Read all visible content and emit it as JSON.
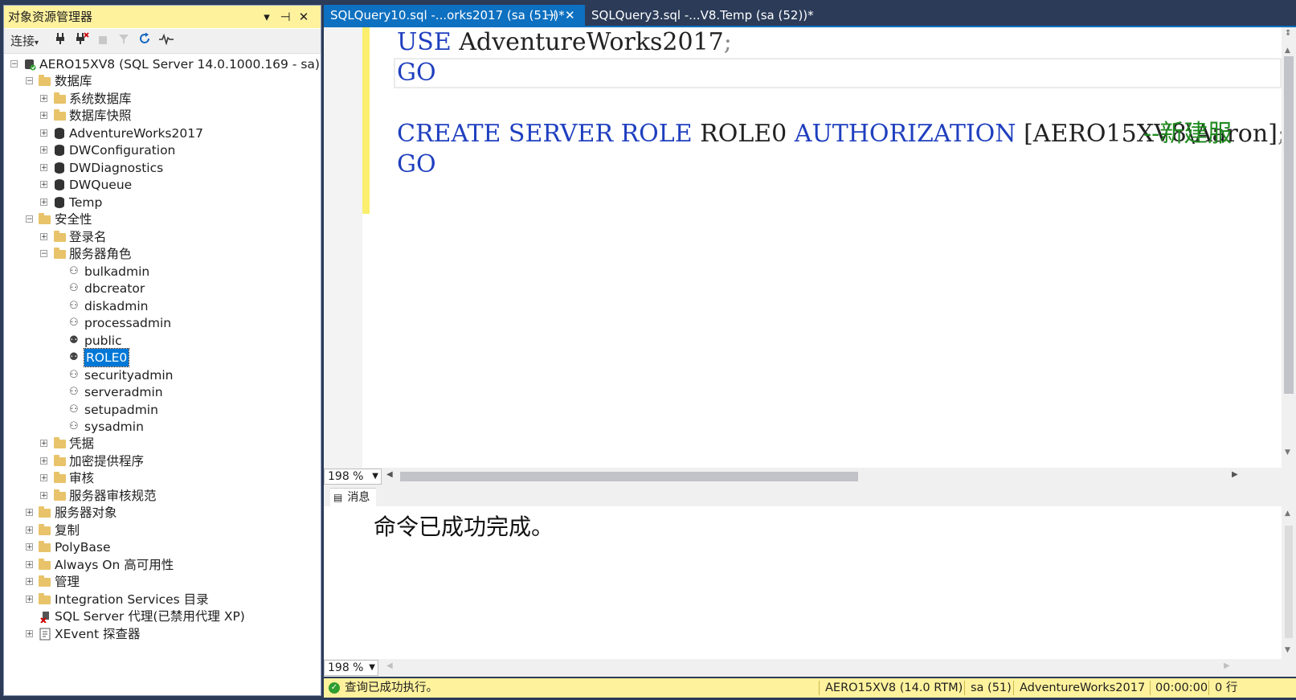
{
  "object_explorer": {
    "title": "对象资源管理器",
    "pin": "⊣",
    "menu": "▾",
    "close": "✕",
    "toolbar": {
      "connect_label": "连接",
      "connect_arrow": "▾"
    },
    "server_node": "AERO15XV8 (SQL Server 14.0.1000.169 - sa)",
    "tree": {
      "databases": "数据库",
      "system_databases": "系统数据库",
      "database_snapshots": "数据库快照",
      "db_adventureworks": "AdventureWorks2017",
      "db_dwconfiguration": "DWConfiguration",
      "db_dwdiagnostics": "DWDiagnostics",
      "db_dwqueue": "DWQueue",
      "db_temp": "Temp",
      "security": "安全性",
      "logins": "登录名",
      "server_roles": "服务器角色",
      "roles": [
        "bulkadmin",
        "dbcreator",
        "diskadmin",
        "processadmin",
        "public",
        "ROLE0",
        "securityadmin",
        "serveradmin",
        "setupadmin",
        "sysadmin"
      ],
      "credentials": "凭据",
      "crypto_providers": "加密提供程序",
      "audits": "审核",
      "server_audit_specs": "服务器审核规范",
      "server_objects": "服务器对象",
      "replication": "复制",
      "polybase": "PolyBase",
      "always_on": "Always On 高可用性",
      "management": "管理",
      "integration_services": "Integration Services 目录",
      "sql_agent": "SQL Server 代理(已禁用代理 XP)",
      "xevent": "XEvent 探查器"
    }
  },
  "tabs": [
    {
      "label": "SQLQuery10.sql -...orks2017 (sa (51))*",
      "pin": "⊣",
      "close": "✕"
    },
    {
      "label": "SQLQuery3.sql -...V8.Temp (sa (52))*"
    }
  ],
  "editor": {
    "line1_kw": "USE",
    "line1_rest": " AdventureWorks2017",
    "line1_semi": ";",
    "line2_kw": "GO",
    "line4_kw1": "CREATE",
    "line4_kw2": "SERVER",
    "line4_kw3": "ROLE",
    "line4_name": "ROLE0",
    "line4_kw4": "AUTHORIZATION",
    "line4_owner": "[AERO15XV8\\Aaron]",
    "line4_semi": ";",
    "line4_comment": "--新建服",
    "line5_kw": "GO"
  },
  "zoom_editor": "198 %",
  "zoom_results": "198 %",
  "results": {
    "tab_label": "消息",
    "message": "命令已成功完成。"
  },
  "status": {
    "message": "查询已成功执行。",
    "server": "AERO15XV8 (14.0 RTM)",
    "user": "sa (51)",
    "database": "AdventureWorks2017",
    "time": "00:00:00",
    "rows": "0 行"
  }
}
